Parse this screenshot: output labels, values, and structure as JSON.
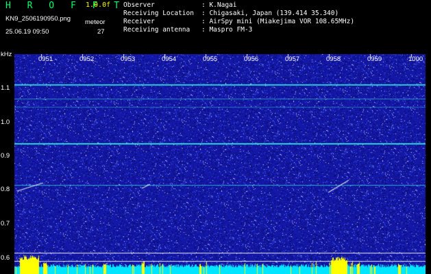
{
  "header": {
    "app_title": "H R O F F T",
    "version": "1.0.0f",
    "filename": "KN9_2506190950.png",
    "meteor_label": "meteor",
    "datetime": "25.06.19 09:50",
    "meteor_count": "27"
  },
  "info": [
    {
      "label": "Observer",
      "value": ": K.Nagai"
    },
    {
      "label": "Receiving Location",
      "value": ": Chigasaki, Japan (139.414 35.340)"
    },
    {
      "label": "Receiver",
      "value": ": AirSpy mini (Miakejima VOR 108.65MHz)"
    },
    {
      "label": "Receiving antenna",
      "value": ": Maspro FM-3"
    }
  ],
  "spectrogram": {
    "y_unit": "kHz",
    "y_ticks": [
      "1.1",
      "1.0",
      "0.9",
      "0.8",
      "0.7",
      "0.6"
    ],
    "y_tick_values": [
      1.1,
      1.0,
      0.9,
      0.8,
      0.7,
      0.6
    ],
    "time_labels": [
      "0951",
      "0952",
      "0953",
      "0954",
      "0955",
      "0956",
      "0957",
      "0958",
      "0959",
      "1000"
    ],
    "colors": {
      "background": "#000000",
      "noise": "#1a1fa8",
      "carrier": "#33dddd",
      "bright": "#ffff00",
      "level": "#00e5ff",
      "accent": "#ffff00"
    }
  }
}
